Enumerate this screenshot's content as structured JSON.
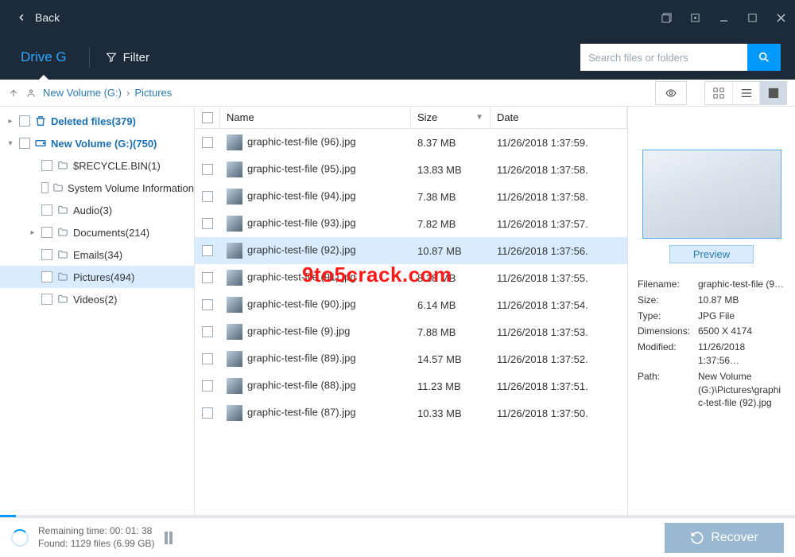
{
  "window": {
    "back_label": "Back"
  },
  "toolbar": {
    "drive_tab": "Drive G",
    "filter_label": "Filter",
    "search_placeholder": "Search files or folders"
  },
  "breadcrumb": {
    "root": "New Volume (G:)",
    "current": "Pictures"
  },
  "tree": {
    "deleted": "Deleted files(379)",
    "volume": "New Volume  (G:)(750)",
    "children": [
      {
        "label": "$RECYCLE.BIN(1)"
      },
      {
        "label": "System Volume Information"
      },
      {
        "label": "Audio(3)"
      },
      {
        "label": "Documents(214)",
        "has_children": true
      },
      {
        "label": "Emails(34)"
      },
      {
        "label": "Pictures(494)",
        "selected": true
      },
      {
        "label": "Videos(2)"
      }
    ]
  },
  "table": {
    "headers": {
      "name": "Name",
      "size": "Size",
      "date": "Date"
    },
    "rows": [
      {
        "name": "graphic-test-file (96).jpg",
        "size": "8.37 MB",
        "date": "11/26/2018 1:37:59."
      },
      {
        "name": "graphic-test-file (95).jpg",
        "size": "13.83 MB",
        "date": "11/26/2018 1:37:58."
      },
      {
        "name": "graphic-test-file (94).jpg",
        "size": "7.38 MB",
        "date": "11/26/2018 1:37:58."
      },
      {
        "name": "graphic-test-file (93).jpg",
        "size": "7.82 MB",
        "date": "11/26/2018 1:37:57."
      },
      {
        "name": "graphic-test-file (92).jpg",
        "size": "10.87 MB",
        "date": "11/26/2018 1:37:56.",
        "selected": true
      },
      {
        "name": "graphic-test-file (91).jpg",
        "size": "8.38 MB",
        "date": "11/26/2018 1:37:55."
      },
      {
        "name": "graphic-test-file (90).jpg",
        "size": "6.14 MB",
        "date": "11/26/2018 1:37:54."
      },
      {
        "name": "graphic-test-file (9).jpg",
        "size": "7.88 MB",
        "date": "11/26/2018 1:37:53."
      },
      {
        "name": "graphic-test-file (89).jpg",
        "size": "14.57 MB",
        "date": "11/26/2018 1:37:52."
      },
      {
        "name": "graphic-test-file (88).jpg",
        "size": "11.23 MB",
        "date": "11/26/2018 1:37:51."
      },
      {
        "name": "graphic-test-file (87).jpg",
        "size": "10.33 MB",
        "date": "11/26/2018 1:37:50."
      }
    ]
  },
  "preview": {
    "button": "Preview",
    "meta": {
      "filename_k": "Filename:",
      "filename_v": "graphic-test-file (9…",
      "size_k": "Size:",
      "size_v": "10.87 MB",
      "type_k": "Type:",
      "type_v": "JPG File",
      "dim_k": "Dimensions:",
      "dim_v": "6500 X 4174",
      "mod_k": "Modified:",
      "mod_v": "11/26/2018 1:37:56…",
      "path_k": "Path:",
      "path_v": "New Volume (G:)\\Pictures\\graphic-test-file (92).jpg"
    }
  },
  "footer": {
    "remaining": "Remaining time: 00: 01: 38",
    "found": "Found: 1129 files (6.99 GB)",
    "recover": "Recover"
  },
  "watermark": "9to5crack.com"
}
